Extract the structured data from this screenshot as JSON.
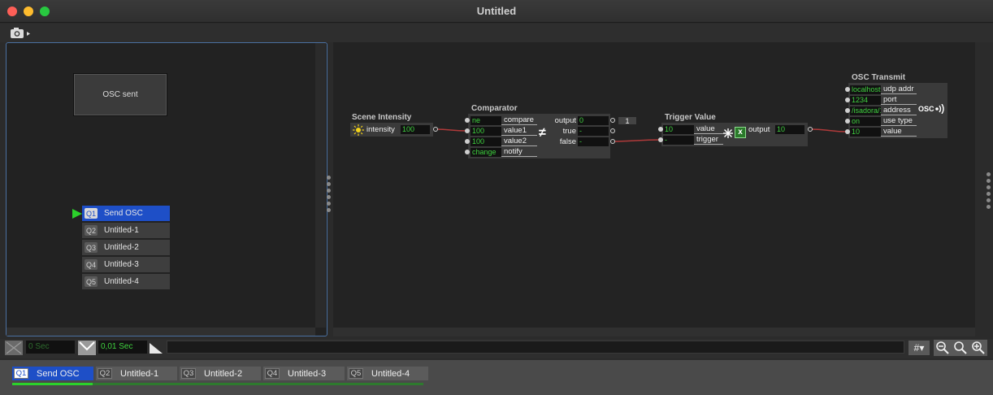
{
  "window": {
    "title": "Untitled"
  },
  "stage": {
    "monitor_label": "OSC sent",
    "scenes": [
      {
        "num": "Q1",
        "name": "Send OSC",
        "active": true
      },
      {
        "num": "Q2",
        "name": "Untitled-1"
      },
      {
        "num": "Q3",
        "name": "Untitled-2"
      },
      {
        "num": "Q4",
        "name": "Untitled-3"
      },
      {
        "num": "Q5",
        "name": "Untitled-4"
      }
    ]
  },
  "actors": {
    "scene_intensity": {
      "title": "Scene Intensity",
      "label": "intensity",
      "value": "100"
    },
    "comparator": {
      "title": "Comparator",
      "inputs": [
        {
          "value": "ne",
          "label": "compare"
        },
        {
          "value": "100",
          "label": "value1"
        },
        {
          "value": "100",
          "label": "value2"
        },
        {
          "value": "change",
          "label": "notify"
        }
      ],
      "outputs": [
        {
          "label": "output",
          "value": "0"
        },
        {
          "label": "true",
          "value": "-"
        },
        {
          "label": "false",
          "value": "-"
        }
      ],
      "symbol": "≠",
      "side_value": "1"
    },
    "trigger_value": {
      "title": "Trigger Value",
      "inputs": [
        {
          "value": "10",
          "label": "value"
        },
        {
          "value": "-",
          "label": "trigger"
        }
      ],
      "output_label": "output",
      "output_value": "10"
    },
    "osc_transmit": {
      "title": "OSC Transmit",
      "inputs": [
        {
          "value": "localhost",
          "label": "udp addr"
        },
        {
          "value": "1234",
          "label": "port"
        },
        {
          "value": "/isadora/1",
          "label": "address"
        },
        {
          "value": "on",
          "label": "use type"
        },
        {
          "value": "10",
          "label": "value"
        }
      ],
      "icon_label": "OSC"
    }
  },
  "controls": {
    "fade_in": "0 Sec",
    "fade_out": "0,01 Sec",
    "grid_label": "#"
  },
  "scene_tabs": [
    {
      "num": "Q1",
      "name": "Send OSC",
      "active": true
    },
    {
      "num": "Q2",
      "name": "Untitled-1"
    },
    {
      "num": "Q3",
      "name": "Untitled-2"
    },
    {
      "num": "Q4",
      "name": "Untitled-3"
    },
    {
      "num": "Q5",
      "name": "Untitled-4"
    }
  ],
  "colors": {
    "accent": "#1e4fc7",
    "value_text": "#3fd13f",
    "link": "#b03a3a",
    "playhead": "#2bd12b"
  }
}
